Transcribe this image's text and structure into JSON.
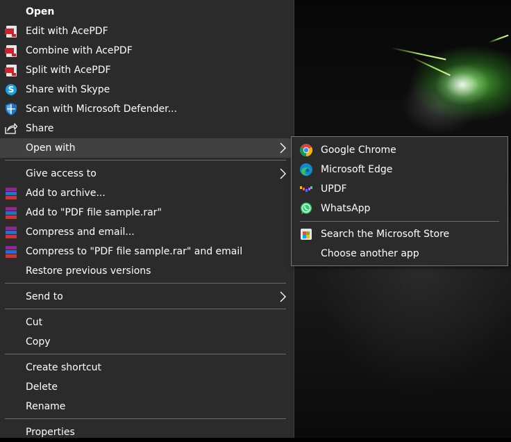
{
  "menu": {
    "items": [
      {
        "label": "Open",
        "icon": "none"
      },
      {
        "label": "Edit with AcePDF",
        "icon": "acepdf-icon"
      },
      {
        "label": "Combine with AcePDF",
        "icon": "acepdf-icon"
      },
      {
        "label": "Split with AcePDF",
        "icon": "acepdf-icon"
      },
      {
        "label": "Share with Skype",
        "icon": "skype-icon"
      },
      {
        "label": "Scan with Microsoft Defender...",
        "icon": "defender-shield-icon"
      },
      {
        "label": "Share",
        "icon": "share-icon"
      },
      {
        "label": "Open with",
        "icon": "none"
      },
      {
        "label": "Give access to",
        "icon": "none"
      },
      {
        "label": "Add to archive...",
        "icon": "winrar-icon"
      },
      {
        "label": "Add to \"PDF file sample.rar\"",
        "icon": "winrar-icon"
      },
      {
        "label": "Compress and email...",
        "icon": "winrar-icon"
      },
      {
        "label": "Compress to \"PDF file sample.rar\" and email",
        "icon": "winrar-icon"
      },
      {
        "label": "Restore previous versions",
        "icon": "none"
      },
      {
        "label": "Send to",
        "icon": "none"
      },
      {
        "label": "Cut",
        "icon": "none"
      },
      {
        "label": "Copy",
        "icon": "none"
      },
      {
        "label": "Create shortcut",
        "icon": "none"
      },
      {
        "label": "Delete",
        "icon": "none"
      },
      {
        "label": "Rename",
        "icon": "none"
      },
      {
        "label": "Properties",
        "icon": "none"
      }
    ]
  },
  "open_with": {
    "items": [
      {
        "label": "Google Chrome",
        "icon": "chrome-icon"
      },
      {
        "label": "Microsoft Edge",
        "icon": "edge-icon"
      },
      {
        "label": "UPDF",
        "icon": "updf-icon"
      },
      {
        "label": "WhatsApp",
        "icon": "whatsapp-icon"
      },
      {
        "label": "Search the Microsoft Store",
        "icon": "microsoft-store-icon"
      },
      {
        "label": "Choose another app",
        "icon": "none"
      }
    ]
  },
  "colors": {
    "menu_bg": "#2b2b2b",
    "highlight": "#414141",
    "separator": "#6b6b6b",
    "text": "#ffffff"
  }
}
